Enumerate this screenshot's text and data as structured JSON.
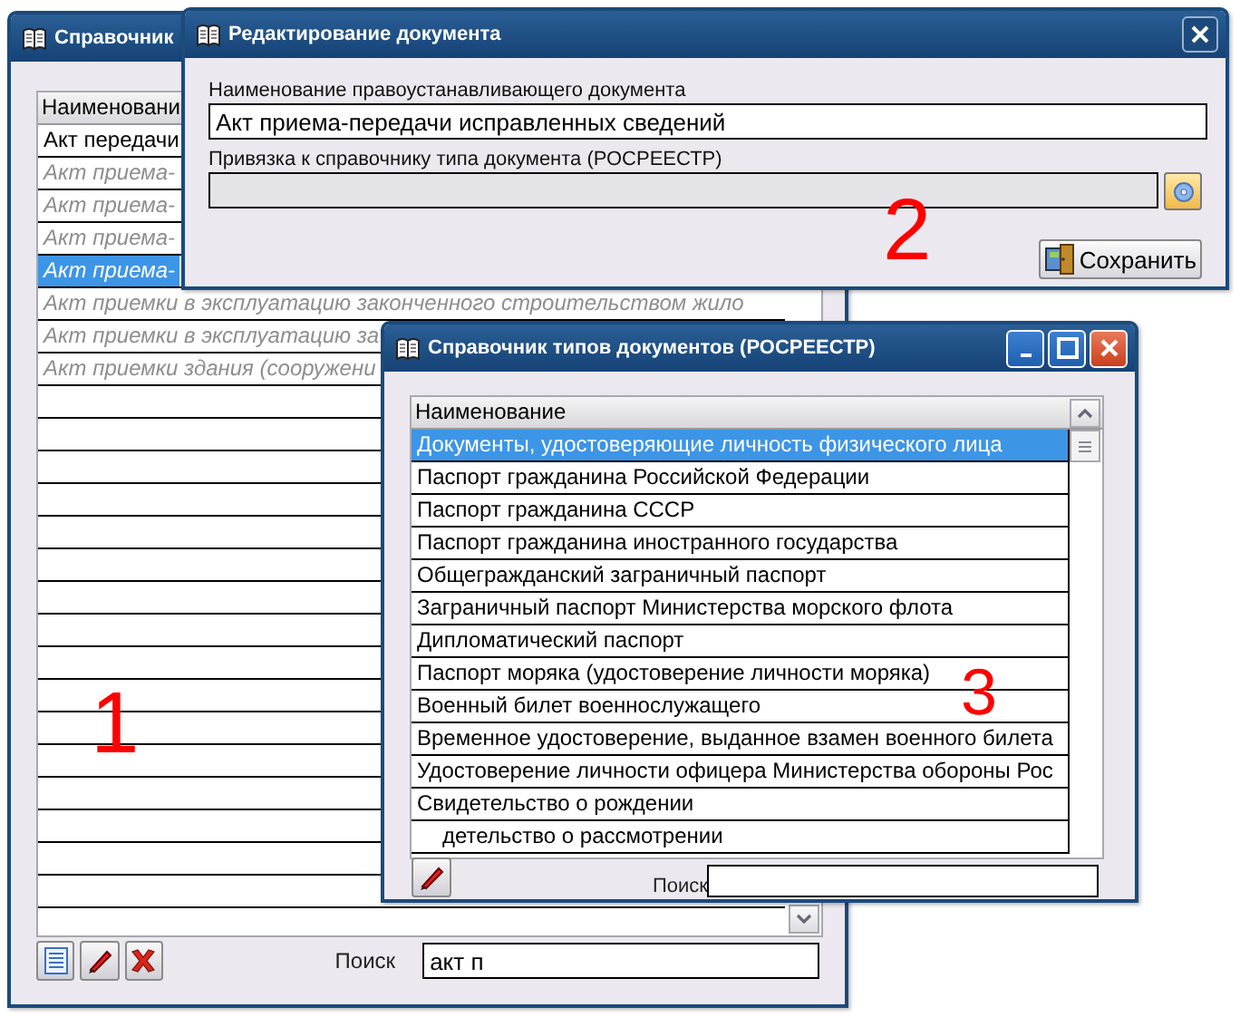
{
  "reference_window": {
    "title": "Справочник",
    "marker": "1",
    "table": {
      "columns": [
        "Наименовани"
      ],
      "rows": [
        {
          "text": "Акт передачи",
          "kind": "normal",
          "selected": false
        },
        {
          "text": "Акт приема-",
          "kind": "inactive",
          "selected": false
        },
        {
          "text": "Акт приема-",
          "kind": "inactive",
          "selected": false
        },
        {
          "text": "Акт приема-",
          "kind": "inactive",
          "selected": false
        },
        {
          "text": "Акт приема-",
          "kind": "inactive",
          "selected": true
        },
        {
          "text": "Акт приемки в эксплуатацию законченного строительством жило",
          "kind": "inactive",
          "selected": false
        },
        {
          "text": "Акт приемки в эксплуатацию за",
          "kind": "inactive",
          "selected": false
        },
        {
          "text": "Акт приемки здания (сооружени",
          "kind": "inactive",
          "selected": false
        }
      ]
    },
    "search": {
      "label": "Поиск",
      "value": "акт п"
    }
  },
  "edit_window": {
    "title": "Редактирование документа",
    "marker": "2",
    "name_field": {
      "label": "Наименование правоустанавливающего документа",
      "value": "Акт приема-передачи исправленных сведений"
    },
    "link_field": {
      "label": "Привязка к справочнику типа документа (РОСРЕЕСТР)"
    },
    "save_button": "Сохранить"
  },
  "types_window": {
    "title": "Справочник типов документов (РОСРЕЕСТР)",
    "marker": "3",
    "table": {
      "columns": [
        "Наименование"
      ],
      "rows": [
        {
          "text": "Документы, удостоверяющие личность физического лица",
          "kind": "full",
          "selected": true
        },
        {
          "text": "Паспорт гражданина Российской Федерации",
          "kind": "full",
          "selected": false
        },
        {
          "text": "Паспорт гражданина СССР",
          "kind": "full",
          "selected": false
        },
        {
          "text": "Паспорт гражданина иностранного государства",
          "kind": "full",
          "selected": false
        },
        {
          "text": "Общегражданский заграничный паспорт",
          "kind": "full",
          "selected": false
        },
        {
          "text": "Заграничный паспорт Министерства морского флота",
          "kind": "full",
          "selected": false
        },
        {
          "text": "Дипломатический паспорт",
          "kind": "full",
          "selected": false
        },
        {
          "text": "Паспорт моряка (удостоверение личности моряка)",
          "kind": "full",
          "selected": false
        },
        {
          "text": "Военный билет военнослужащего",
          "kind": "full",
          "selected": false
        },
        {
          "text": "Временное удостоверение, выданное взамен военного билета",
          "kind": "full",
          "selected": false
        },
        {
          "text": "Удостоверение личности офицера Министерства обороны Рос",
          "kind": "full",
          "selected": false
        },
        {
          "text": "Свидетельство о рождении",
          "kind": "full",
          "selected": false
        },
        {
          "text": "детельство о рассмотрении",
          "kind": "partial",
          "selected": false
        }
      ]
    },
    "search": {
      "label": "Поиск"
    }
  }
}
